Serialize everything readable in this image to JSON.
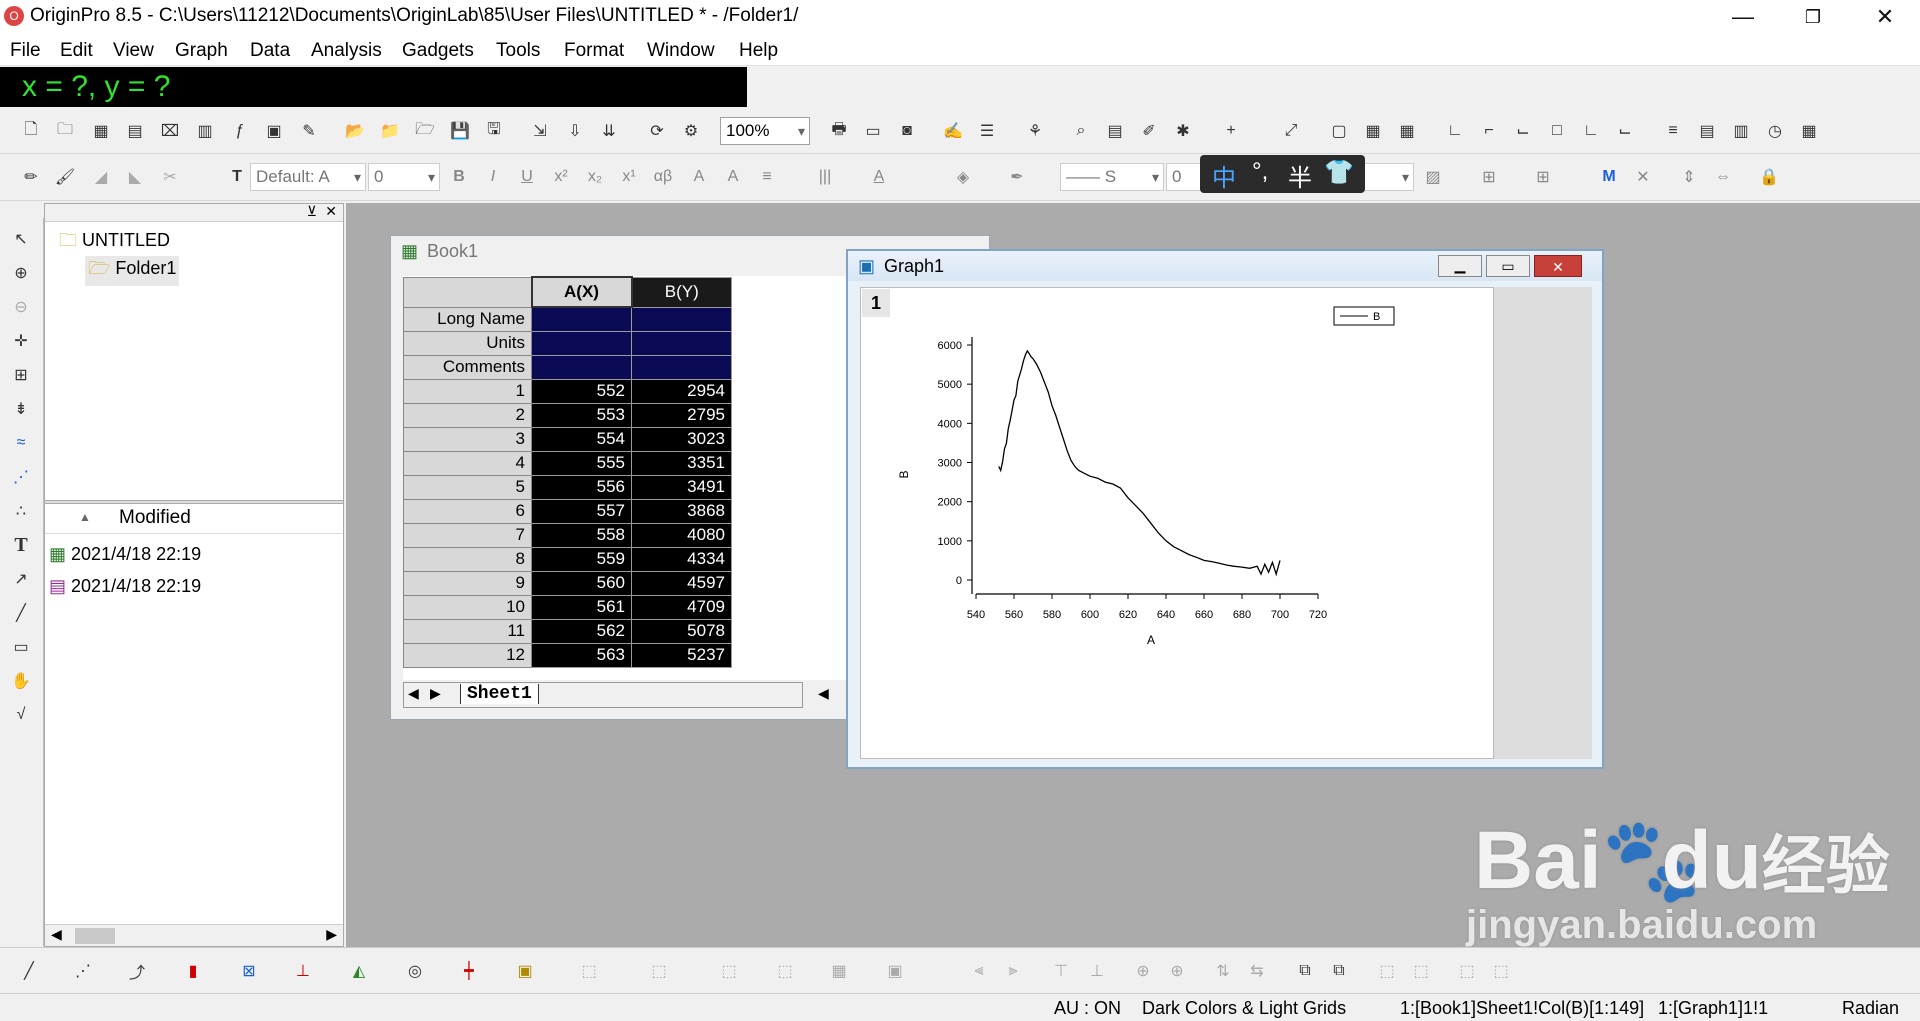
{
  "window": {
    "title": "OriginPro 8.5 - C:\\Users\\11212\\Documents\\OriginLab\\85\\User Files\\UNTITLED * - /Folder1/",
    "minimize": "—",
    "restore": "❐",
    "close": "✕"
  },
  "menu": [
    "File",
    "Edit",
    "View",
    "Graph",
    "Data",
    "Analysis",
    "Gadgets",
    "Tools",
    "Format",
    "Window",
    "Help"
  ],
  "coords_readout": "x = ?, y = ?",
  "toolbar": {
    "zoom_value": "100%",
    "font_value": "Default: A",
    "font_size_value": "0",
    "line_width_value": "0",
    "line_style_preview": "S"
  },
  "ime": {
    "lang": "中",
    "punct": "°,",
    "width": "半"
  },
  "explorer": {
    "root": "UNTITLED",
    "child": "Folder1",
    "column_header": "Modified",
    "files": [
      {
        "modified": "2021/4/18 22:19",
        "icon": "workbook-icon"
      },
      {
        "modified": "2021/4/18 22:19",
        "icon": "graph-icon"
      }
    ]
  },
  "book": {
    "title": "Book1",
    "columns": [
      "A(X)",
      "B(Y)"
    ],
    "header_rows": [
      "Long Name",
      "Units",
      "Comments"
    ],
    "rows": [
      [
        "1",
        "552",
        "2954"
      ],
      [
        "2",
        "553",
        "2795"
      ],
      [
        "3",
        "554",
        "3023"
      ],
      [
        "4",
        "555",
        "3351"
      ],
      [
        "5",
        "556",
        "3491"
      ],
      [
        "6",
        "557",
        "3868"
      ],
      [
        "7",
        "558",
        "4080"
      ],
      [
        "8",
        "559",
        "4334"
      ],
      [
        "9",
        "560",
        "4597"
      ],
      [
        "10",
        "561",
        "4709"
      ],
      [
        "11",
        "562",
        "5078"
      ],
      [
        "12",
        "563",
        "5237"
      ]
    ],
    "sheet_tab": "Sheet1"
  },
  "graph": {
    "title": "Graph1",
    "layer": "1",
    "legend": "B"
  },
  "chart_data": {
    "type": "line",
    "title": "",
    "xlabel": "A",
    "ylabel": "B",
    "xlim": [
      540,
      720
    ],
    "ylim": [
      0,
      6000
    ],
    "xticks": [
      "540",
      "560",
      "580",
      "600",
      "620",
      "640",
      "660",
      "680",
      "700",
      "720"
    ],
    "yticks": [
      "0",
      "1000",
      "2000",
      "3000",
      "4000",
      "5000",
      "6000"
    ],
    "series": [
      {
        "name": "B",
        "x": [
          552,
          553,
          554,
          555,
          556,
          557,
          558,
          559,
          560,
          561,
          562,
          563,
          564,
          565,
          566,
          567,
          568,
          569,
          570,
          572,
          574,
          576,
          578,
          580,
          582,
          584,
          586,
          588,
          590,
          592,
          594,
          596,
          598,
          600,
          604,
          608,
          612,
          616,
          620,
          624,
          628,
          632,
          636,
          640,
          644,
          648,
          652,
          656,
          660,
          664,
          668,
          672,
          676,
          680,
          684,
          688,
          690,
          692,
          694,
          696,
          698,
          700
        ],
        "y": [
          2900,
          2795,
          3023,
          3351,
          3491,
          3868,
          4080,
          4334,
          4597,
          4709,
          5078,
          5237,
          5400,
          5600,
          5750,
          5850,
          5780,
          5700,
          5650,
          5500,
          5300,
          5050,
          4800,
          4450,
          4200,
          3900,
          3600,
          3300,
          3050,
          2900,
          2800,
          2750,
          2700,
          2650,
          2600,
          2500,
          2450,
          2350,
          2100,
          1900,
          1700,
          1450,
          1200,
          1000,
          850,
          750,
          650,
          580,
          500,
          470,
          430,
          380,
          350,
          330,
          300,
          350,
          150,
          400,
          200,
          450,
          150,
          500
        ]
      }
    ]
  },
  "status": {
    "au": "AU : ON",
    "theme": "Dark Colors & Light Grids",
    "cell": "1:[Book1]Sheet1!Col(B)[1:149]",
    "graph": "1:[Graph1]1!1",
    "angle": "Radian"
  },
  "watermark": {
    "brand": "Bai",
    "brand2": "du",
    "cn": "经验",
    "url": "jingyan.baidu.com"
  }
}
